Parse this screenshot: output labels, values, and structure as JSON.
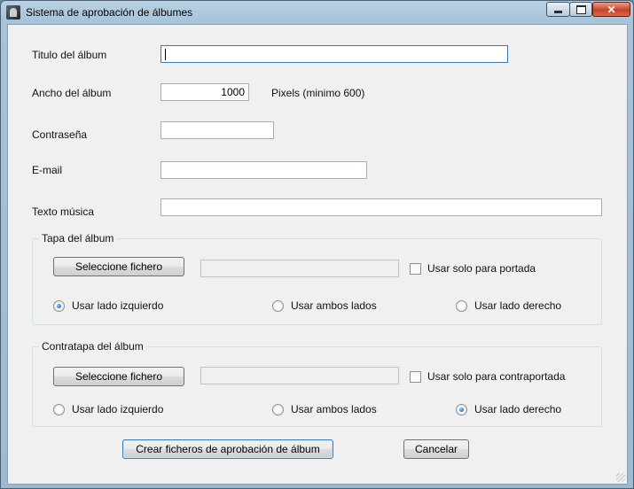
{
  "window": {
    "title": "Sistema de aprobación de álbumes",
    "controls": {
      "minimize": "minimize",
      "maximize": "maximize",
      "close": "✕"
    }
  },
  "form": {
    "album_title": {
      "label": "Titulo del álbum",
      "value": ""
    },
    "album_width": {
      "label": "Ancho del álbum",
      "value": "1000",
      "hint": "Pixels (minimo 600)"
    },
    "password": {
      "label": "Contraseña",
      "value": ""
    },
    "email": {
      "label": "E-mail",
      "value": ""
    },
    "music_text": {
      "label": "Texto música",
      "value": ""
    }
  },
  "front_cover": {
    "title": "Tapa del álbum",
    "select_button": "Seleccione fichero",
    "file_path": "",
    "checkbox_label": "Usar solo para portada",
    "checkbox_checked": false,
    "radios": [
      {
        "label": "Usar lado izquierdo",
        "checked": true
      },
      {
        "label": "Usar ambos lados",
        "checked": false
      },
      {
        "label": "Usar lado derecho",
        "checked": false
      }
    ]
  },
  "back_cover": {
    "title": "Contratapa del álbum",
    "select_button": "Seleccione fichero",
    "file_path": "",
    "checkbox_label": "Usar solo para contraportada",
    "checkbox_checked": false,
    "radios": [
      {
        "label": "Usar lado izquierdo",
        "checked": false
      },
      {
        "label": "Usar ambos lados",
        "checked": false
      },
      {
        "label": "Usar lado derecho",
        "checked": true
      }
    ]
  },
  "actions": {
    "create": "Crear ficheros de aprobación de álbum",
    "cancel": "Cancelar"
  },
  "colors": {
    "accent": "#3c7fb1",
    "radio_selected": "#0d4a8a",
    "close_button": "#c64326"
  }
}
